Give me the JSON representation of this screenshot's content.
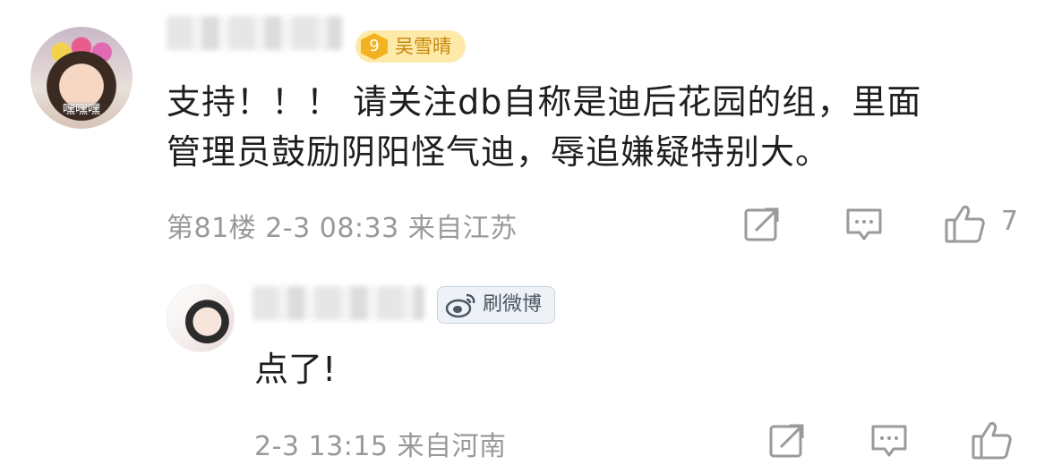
{
  "comment": {
    "author_badge_level": "9",
    "author_badge_label": "吴雪晴",
    "avatar_tag": "嘿嘿嘿",
    "text_line1": "支持！！！ 请关注db自称是迪后花园的组，里面",
    "text_line2": "管理员鼓励阴阳怪气迪，辱追嫌疑特别大。",
    "meta": "第81楼  2-3 08:33  来自江苏",
    "like_count": "7"
  },
  "reply": {
    "badge_label": "刷微博",
    "text": "点了!",
    "meta": "2-3 13:15  来自河南"
  },
  "icons": {
    "share": "share-edit-icon",
    "comment": "comment-icon",
    "like": "thumbs-up-icon",
    "weibo": "weibo-logo-icon"
  },
  "colors": {
    "vip_badge_bg": "#fde9a8",
    "vip_badge_text": "#c7860a",
    "meta_text": "#999999"
  }
}
